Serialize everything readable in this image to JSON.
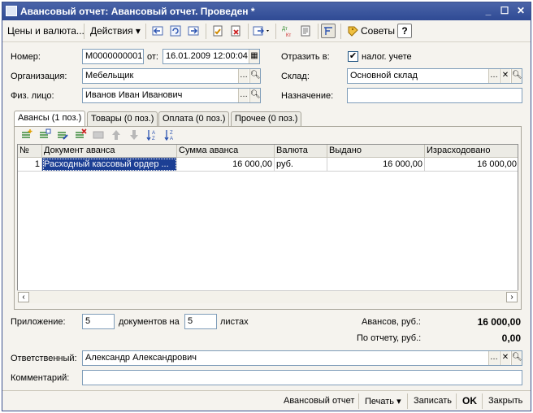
{
  "window": {
    "title": "Авансовый отчет: Авансовый отчет. Проведен *"
  },
  "toolbar": {
    "prices_label": "Цены и валюта...",
    "actions_label": "Действия",
    "tips_label": "Советы",
    "help_label": "?"
  },
  "header": {
    "number_label": "Номер:",
    "number_value": "М0000000001",
    "from_label": "от:",
    "date_value": "16.01.2009 12:00:04",
    "reflect_label": "Отразить в:",
    "tax_checkbox_label": "налог. учете",
    "tax_checked": true,
    "org_label": "Организация:",
    "org_value": "Мебельщик",
    "warehouse_label": "Склад:",
    "warehouse_value": "Основной склад",
    "person_label": "Физ. лицо:",
    "person_value": "Иванов Иван Иванович",
    "purpose_label": "Назначение:",
    "purpose_value": ""
  },
  "tabs": [
    {
      "label": "Авансы (1 поз.)"
    },
    {
      "label": "Товары (0 поз.)"
    },
    {
      "label": "Оплата (0 поз.)"
    },
    {
      "label": "Прочее (0 поз.)"
    }
  ],
  "table": {
    "columns": [
      "№",
      "Документ аванса",
      "Сумма аванса",
      "Валюта",
      "Выдано",
      "Израсходовано"
    ],
    "rows": [
      [
        "1",
        "Расходный кассовый ордер ...",
        "16 000,00",
        "руб.",
        "16 000,00",
        "16 000,00"
      ]
    ]
  },
  "footer": {
    "attachment_label": "Приложение:",
    "attachment_docs": "5",
    "docs_on_label": "документов на",
    "attachment_sheets": "5",
    "sheets_label": "листах",
    "advances_label": "Авансов, руб.:",
    "advances_value": "16 000,00",
    "by_report_label": "По отчету, руб.:",
    "by_report_value": "0,00",
    "responsible_label": "Ответственный:",
    "responsible_value": "Александр Александрович",
    "comment_label": "Комментарий:",
    "comment_value": ""
  },
  "bottom_bar": {
    "report_label": "Авансовый отчет",
    "print_label": "Печать",
    "record_label": "Записать",
    "ok_label": "OK",
    "close_label": "Закрыть"
  },
  "colors": {
    "title_bar": "#2f4a94",
    "selected_cell": "#1c3f94"
  }
}
